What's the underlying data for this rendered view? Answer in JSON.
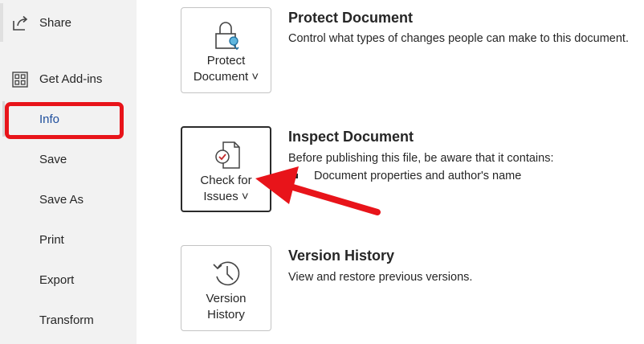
{
  "sidebar": {
    "items": [
      {
        "label": "Share",
        "icon": "share-icon"
      },
      {
        "label": "Get Add-ins",
        "icon": "add-ins-grid-icon"
      },
      {
        "label": "Info",
        "active": true
      },
      {
        "label": "Save"
      },
      {
        "label": "Save As"
      },
      {
        "label": "Print"
      },
      {
        "label": "Export"
      },
      {
        "label": "Transform"
      }
    ]
  },
  "sections": {
    "protect": {
      "tile_line1": "Protect",
      "tile_line2": "Document ˅",
      "title": "Protect Document",
      "description": "Control what types of changes people can make to this document."
    },
    "inspect": {
      "tile_line1": "Check for",
      "tile_line2": "Issues ˅",
      "title": "Inspect Document",
      "description": "Before publishing this file, be aware that it contains:",
      "bullets": [
        "Document properties and author's name"
      ]
    },
    "version": {
      "tile_line1": "Version",
      "tile_line2": "History",
      "title": "Version History",
      "description": "View and restore previous versions."
    }
  },
  "colors": {
    "highlight": "#e8141a",
    "active_text": "#1e4e9c",
    "sidebar_bg": "#f2f2f2"
  }
}
